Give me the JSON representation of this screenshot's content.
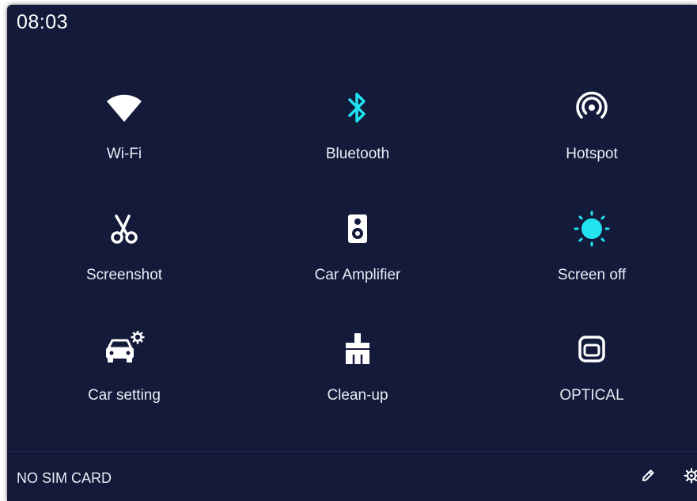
{
  "status_bar": {
    "time": "08:03"
  },
  "tiles": [
    {
      "label": "Wi-Fi",
      "icon": "wifi-icon",
      "active": false
    },
    {
      "label": "Bluetooth",
      "icon": "bluetooth-icon",
      "active": true
    },
    {
      "label": "Hotspot",
      "icon": "hotspot-icon",
      "active": false
    },
    {
      "label": "Screenshot",
      "icon": "screenshot-icon",
      "active": false
    },
    {
      "label": "Car Amplifier",
      "icon": "speaker-icon",
      "active": false
    },
    {
      "label": "Screen off",
      "icon": "sun-icon",
      "active": true
    },
    {
      "label": "Car setting",
      "icon": "car-settings-icon",
      "active": false
    },
    {
      "label": "Clean-up",
      "icon": "broom-icon",
      "active": false
    },
    {
      "label": "OPTICAL",
      "icon": "optical-icon",
      "active": false
    }
  ],
  "footer": {
    "sim_status": "NO SIM CARD",
    "edit_icon": "pencil-icon",
    "settings_icon": "gear-icon"
  },
  "colors": {
    "background": "#141b3a",
    "active_accent": "#21e3f0",
    "icon_default": "#ffffff",
    "text": "#e9ecf4"
  }
}
